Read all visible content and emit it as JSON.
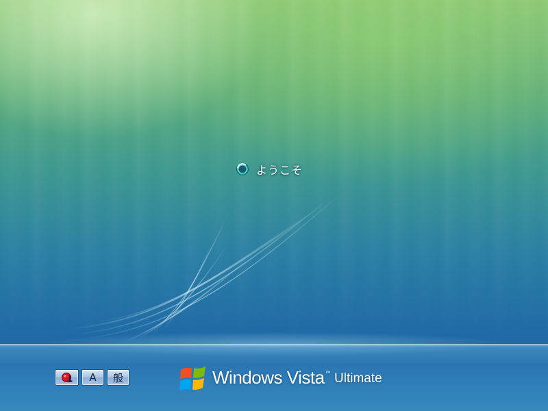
{
  "screen": {
    "welcome_text": "ようこそ",
    "status_icon": "loading-spinner-icon"
  },
  "ime_bar": {
    "buttons": [
      {
        "icon": "ease-of-access-icon",
        "label": ""
      },
      {
        "icon": "input-mode-icon",
        "label": "A"
      },
      {
        "icon": "conversion-mode-icon",
        "label": "般"
      }
    ]
  },
  "branding": {
    "logo_icon": "windows-flag-icon",
    "product": "Windows Vista",
    "trademark": "™",
    "edition": "Ultimate"
  },
  "colors": {
    "sky_top": "#8cc876",
    "sky_bottom": "#1f6aa6",
    "text": "#ffffff",
    "button_border": "#2d4f7a"
  }
}
